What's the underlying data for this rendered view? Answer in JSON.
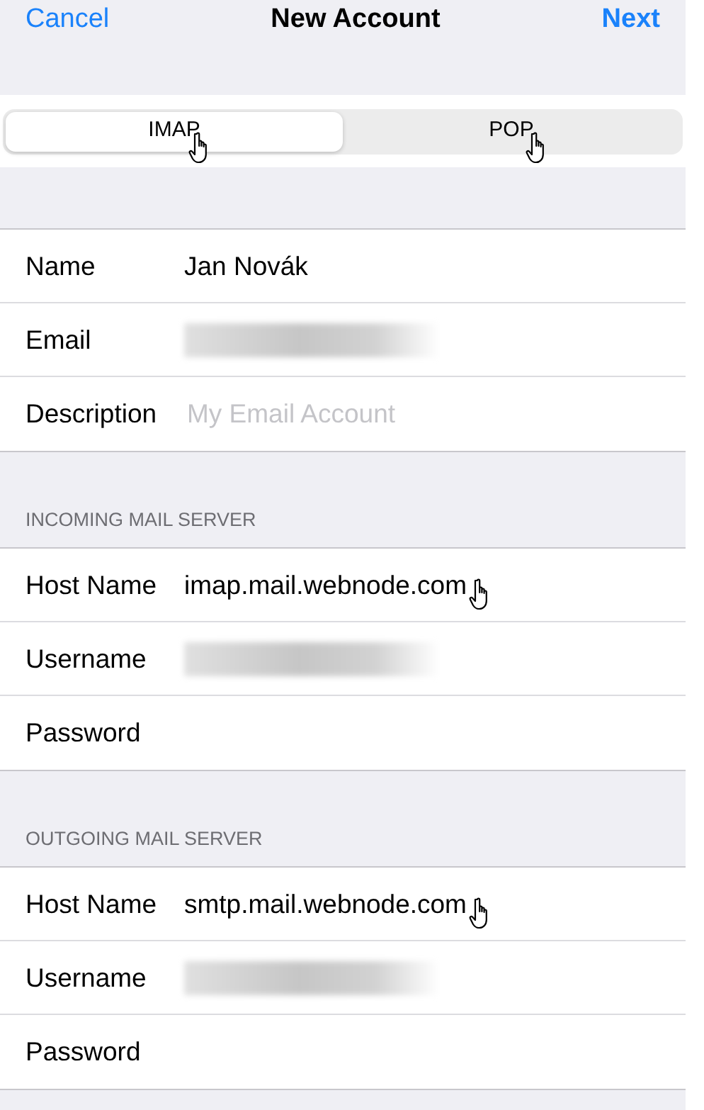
{
  "nav": {
    "cancel": "Cancel",
    "title": "New Account",
    "next": "Next"
  },
  "segments": [
    {
      "label": "IMAP",
      "selected": true,
      "pointer": true
    },
    {
      "label": "POP",
      "selected": false,
      "pointer": true
    }
  ],
  "sections": [
    {
      "rows": [
        {
          "label": "Name",
          "kind": "value",
          "value": "Jan Novák",
          "pointer": false
        },
        {
          "label": "Email",
          "kind": "redacted",
          "pointer": false
        },
        {
          "label": "Description",
          "kind": "placeholder",
          "placeholder": "My Email Account",
          "pointer": false
        }
      ]
    },
    {
      "header": "INCOMING MAIL SERVER",
      "rows": [
        {
          "label": "Host Name",
          "kind": "value",
          "value": "imap.mail.webnode.com",
          "pointer": true
        },
        {
          "label": "Username",
          "kind": "redacted",
          "pointer": false
        },
        {
          "label": "Password",
          "kind": "empty",
          "pointer": false
        }
      ]
    },
    {
      "header": "OUTGOING MAIL SERVER",
      "rows": [
        {
          "label": "Host Name",
          "kind": "value",
          "value": "smtp.mail.webnode.com",
          "pointer": true
        },
        {
          "label": "Username",
          "kind": "redacted",
          "pointer": false
        },
        {
          "label": "Password",
          "kind": "empty",
          "pointer": false
        }
      ]
    }
  ]
}
